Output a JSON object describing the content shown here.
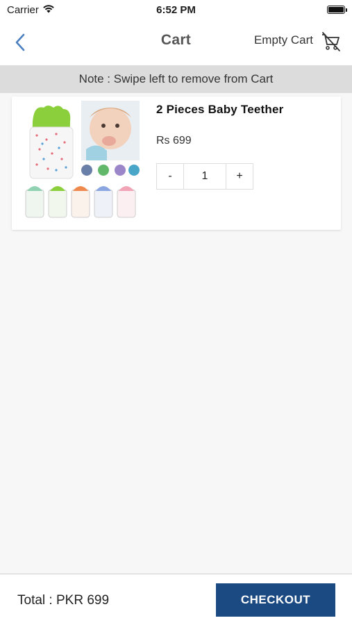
{
  "status_bar": {
    "carrier": "Carrier",
    "time": "6:52 PM"
  },
  "nav": {
    "title": "Cart",
    "empty_cart_label": "Empty Cart"
  },
  "note": "Note : Swipe left to remove from Cart",
  "cart_items": [
    {
      "name": "2 Pieces Baby Teether",
      "price": "Rs 699",
      "quantity": "1",
      "decrement_label": "-",
      "increment_label": "+"
    }
  ],
  "footer": {
    "total": "Total : PKR 699",
    "checkout_label": "CHECKOUT"
  },
  "colors": {
    "accent": "#1b4a82",
    "back_arrow": "#4a7fc1",
    "note_bg": "#dcdcdc"
  },
  "icons": [
    "wifi-icon",
    "battery-icon",
    "chevron-left-icon",
    "cart-remove-icon"
  ]
}
